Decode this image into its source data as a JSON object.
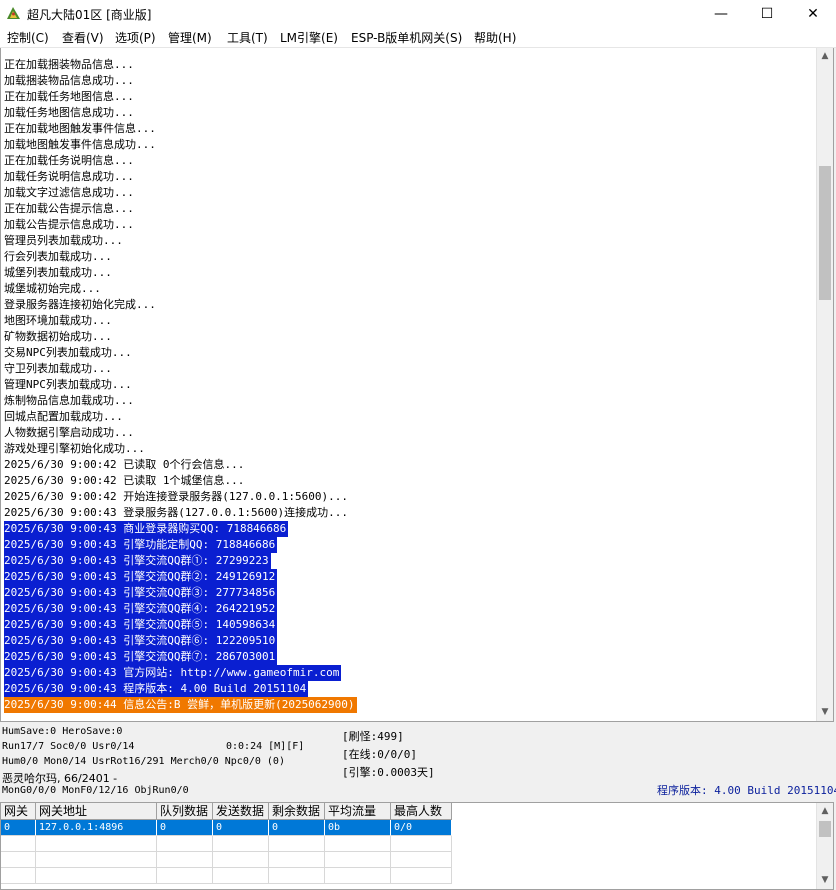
{
  "window": {
    "title": "超凡大陆01区 [商业版]",
    "controls": {
      "minimize": "—",
      "maximize": "☐",
      "close": "✕"
    }
  },
  "menu": [
    "控制(C)",
    "查看(V)",
    "选项(P)",
    "管理(M)",
    "工具(T)",
    "LM引擎(E)",
    "ESP-B版单机网关(S)",
    "帮助(H)"
  ],
  "log": {
    "lines": [
      {
        "text": "正在加载捆装物品信息...",
        "style": "normal"
      },
      {
        "text": "加载捆装物品信息成功...",
        "style": "normal"
      },
      {
        "text": "正在加载任务地图信息...",
        "style": "normal"
      },
      {
        "text": "加载任务地图信息成功...",
        "style": "normal"
      },
      {
        "text": "正在加载地图触发事件信息...",
        "style": "normal"
      },
      {
        "text": "加载地图触发事件信息成功...",
        "style": "normal"
      },
      {
        "text": "正在加载任务说明信息...",
        "style": "normal"
      },
      {
        "text": "加载任务说明信息成功...",
        "style": "normal"
      },
      {
        "text": "加载文字过滤信息成功...",
        "style": "normal"
      },
      {
        "text": "正在加载公告提示信息...",
        "style": "normal"
      },
      {
        "text": "加载公告提示信息成功...",
        "style": "normal"
      },
      {
        "text": "管理员列表加载成功...",
        "style": "normal"
      },
      {
        "text": "行会列表加载成功...",
        "style": "normal"
      },
      {
        "text": "城堡列表加载成功...",
        "style": "normal"
      },
      {
        "text": "城堡城初始完成...",
        "style": "normal"
      },
      {
        "text": "登录服务器连接初始化完成...",
        "style": "normal"
      },
      {
        "text": "地图环境加载成功...",
        "style": "normal"
      },
      {
        "text": "矿物数据初始成功...",
        "style": "normal"
      },
      {
        "text": "交易NPC列表加载成功...",
        "style": "normal"
      },
      {
        "text": "守卫列表加载成功...",
        "style": "normal"
      },
      {
        "text": "管理NPC列表加载成功...",
        "style": "normal"
      },
      {
        "text": "炼制物品信息加载成功...",
        "style": "normal"
      },
      {
        "text": "回城点配置加载成功...",
        "style": "normal"
      },
      {
        "text": "人物数据引擎启动成功...",
        "style": "normal"
      },
      {
        "text": "游戏处理引擎初始化成功...",
        "style": "normal"
      },
      {
        "text": "2025/6/30 9:00:42 已读取 0个行会信息...",
        "style": "normal"
      },
      {
        "text": "2025/6/30 9:00:42 已读取 1个城堡信息...",
        "style": "normal"
      },
      {
        "text": "2025/6/30 9:00:42 开始连接登录服务器(127.0.0.1:5600)...",
        "style": "normal"
      },
      {
        "text": "2025/6/30 9:00:43 登录服务器(127.0.0.1:5600)连接成功...",
        "style": "normal"
      },
      {
        "text": "2025/6/30 9:00:43 商业登录器购买QQ: 718846686",
        "style": "sel-blue"
      },
      {
        "text": "2025/6/30 9:00:43 引擎功能定制QQ: 718846686",
        "style": "sel-blue"
      },
      {
        "text": "2025/6/30 9:00:43 引擎交流QQ群①: 27299223",
        "style": "sel-blue"
      },
      {
        "text": "2025/6/30 9:00:43 引擎交流QQ群②: 249126912",
        "style": "sel-blue"
      },
      {
        "text": "2025/6/30 9:00:43 引擎交流QQ群③: 277734856",
        "style": "sel-blue"
      },
      {
        "text": "2025/6/30 9:00:43 引擎交流QQ群④: 264221952",
        "style": "sel-blue"
      },
      {
        "text": "2025/6/30 9:00:43 引擎交流QQ群⑤: 140598634",
        "style": "sel-blue"
      },
      {
        "text": "2025/6/30 9:00:43 引擎交流QQ群⑥: 122209510",
        "style": "sel-blue"
      },
      {
        "text": "2025/6/30 9:00:43 引擎交流QQ群⑦: 286703001",
        "style": "sel-blue"
      },
      {
        "text": "2025/6/30 9:00:43 官方网站: http://www.gameofmir.com",
        "style": "sel-blue"
      },
      {
        "text": "2025/6/30 9:00:43 程序版本: 4.00 Build 20151104",
        "style": "sel-blue"
      },
      {
        "text": "2025/6/30 9:00:44 信息公告:B 尝鲜，单机版更新(2025062900)",
        "style": "sel-orange"
      }
    ],
    "scroll_up": "▲",
    "scroll_down": "▼"
  },
  "status": {
    "line1": "HumSave:0 HeroSave:0",
    "line2": "Run17/7 Soc0/0 Usr0/14",
    "timer": "0:0:24 [M][F]",
    "line3": "Hum0/0 Mon0/14 UsrRot16/291 Merch0/0 Npc0/0 (0)",
    "line4": "恶灵哈尔玛, 66/2401 -",
    "line5": "MonG0/0/0 MonF0/12/16 ObjRun0/0",
    "refresh": "[刷怪:499]",
    "online": "[在线:0/0/0]",
    "engine": "[引擎:0.0003天]",
    "version": "程序版本: 4.00 Build 20151104"
  },
  "gateway": {
    "headers": [
      "网关",
      "网关地址",
      "队列数据",
      "发送数据",
      "剩余数据",
      "平均流量",
      "最高人数"
    ],
    "rows": [
      [
        "0",
        "127.0.0.1:4896",
        "0",
        "0",
        "0",
        "0b",
        "0/0"
      ]
    ],
    "scroll_up": "▲",
    "scroll_down": "▼"
  }
}
